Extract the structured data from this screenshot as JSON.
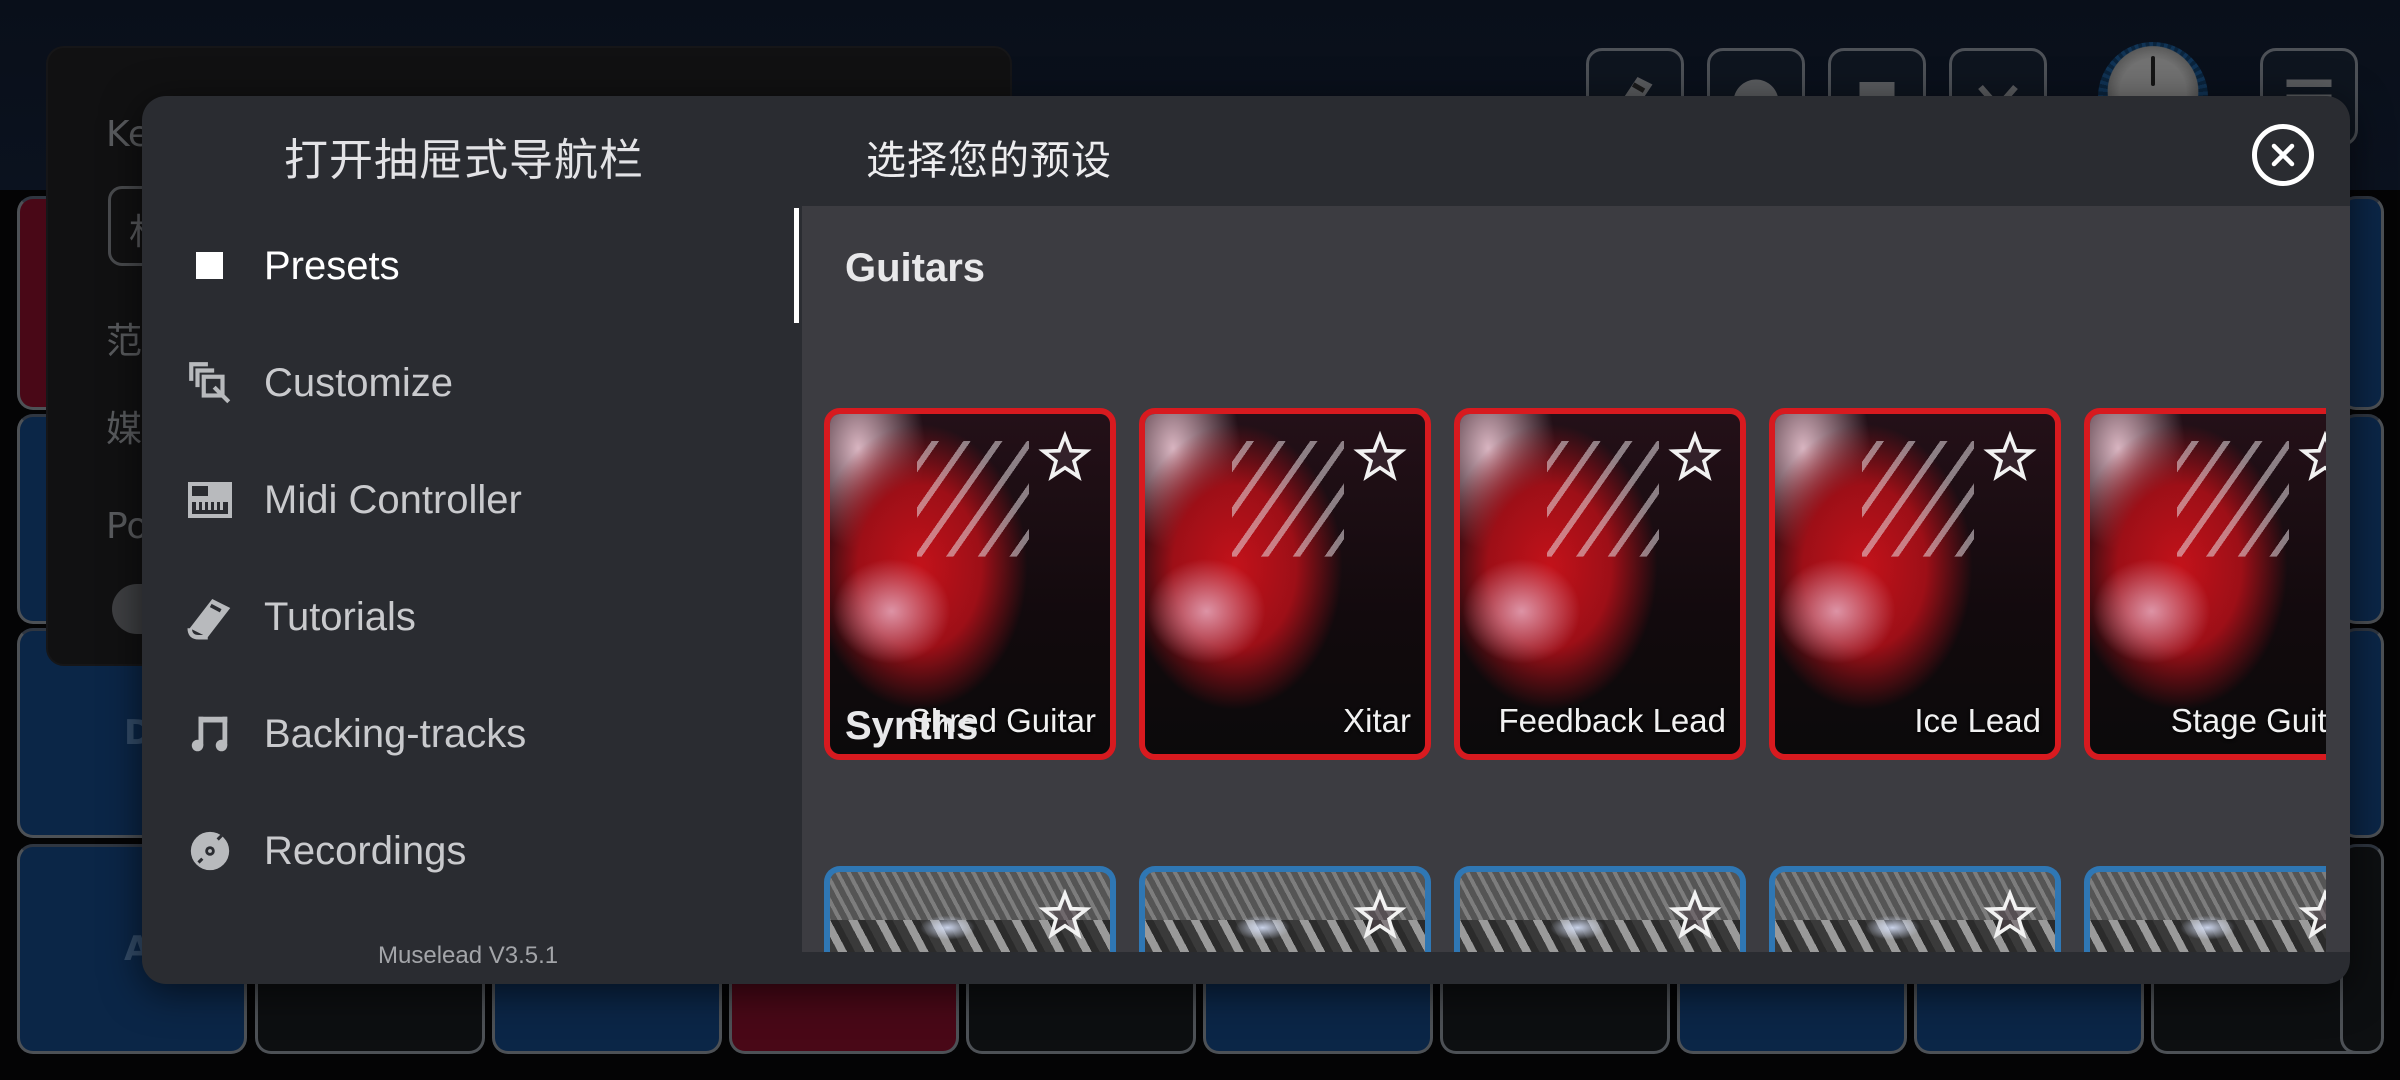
{
  "background_app": {
    "panel_fragments": [
      "Ke",
      "杉",
      "范",
      "媒",
      "Po"
    ],
    "pad_labels": [
      "D",
      "A"
    ],
    "toolbar_icons": [
      "book-icon",
      "disc-icon",
      "save-icon",
      "chevron-down-icon",
      "volume-knob",
      "menu-icon"
    ]
  },
  "drawer": {
    "title": "打开抽屉式导航栏",
    "nav_items": [
      {
        "label": "Presets",
        "icon": "square-icon",
        "active": true
      },
      {
        "label": "Customize",
        "icon": "customize-icon",
        "active": false
      },
      {
        "label": "Midi Controller",
        "icon": "keyboard-icon",
        "active": false
      },
      {
        "label": "Tutorials",
        "icon": "book-icon",
        "active": false
      },
      {
        "label": "Backing-tracks",
        "icon": "music-note-icon",
        "active": false
      },
      {
        "label": "Recordings",
        "icon": "disc-icon",
        "active": false
      }
    ],
    "version": "Muselead V3.5.1"
  },
  "presets": {
    "title": "选择您的预设",
    "close_icon": "close-circle-icon",
    "sections": [
      {
        "title": "Guitars",
        "accent": "#d81a1f",
        "items": [
          {
            "name": "Shred Guitar",
            "favorite": false
          },
          {
            "name": "Xitar",
            "favorite": false
          },
          {
            "name": "Feedback Lead",
            "favorite": false
          },
          {
            "name": "Ice Lead",
            "favorite": false
          },
          {
            "name": "Stage Guitar",
            "favorite": false
          }
        ]
      },
      {
        "title": "Synths",
        "accent": "#2f77b4",
        "items": [
          {
            "name": "",
            "favorite": false
          },
          {
            "name": "",
            "favorite": false
          },
          {
            "name": "",
            "favorite": false
          },
          {
            "name": "",
            "favorite": false
          },
          {
            "name": "",
            "favorite": false
          }
        ]
      }
    ]
  },
  "colors": {
    "drawer_bg": "#2a2c31",
    "content_bg": "#3c3c41",
    "guitar_border": "#d81a1f",
    "synth_border": "#2f77b4",
    "pad_blue": "#0e2f57",
    "pad_red": "#5a0a1d"
  }
}
